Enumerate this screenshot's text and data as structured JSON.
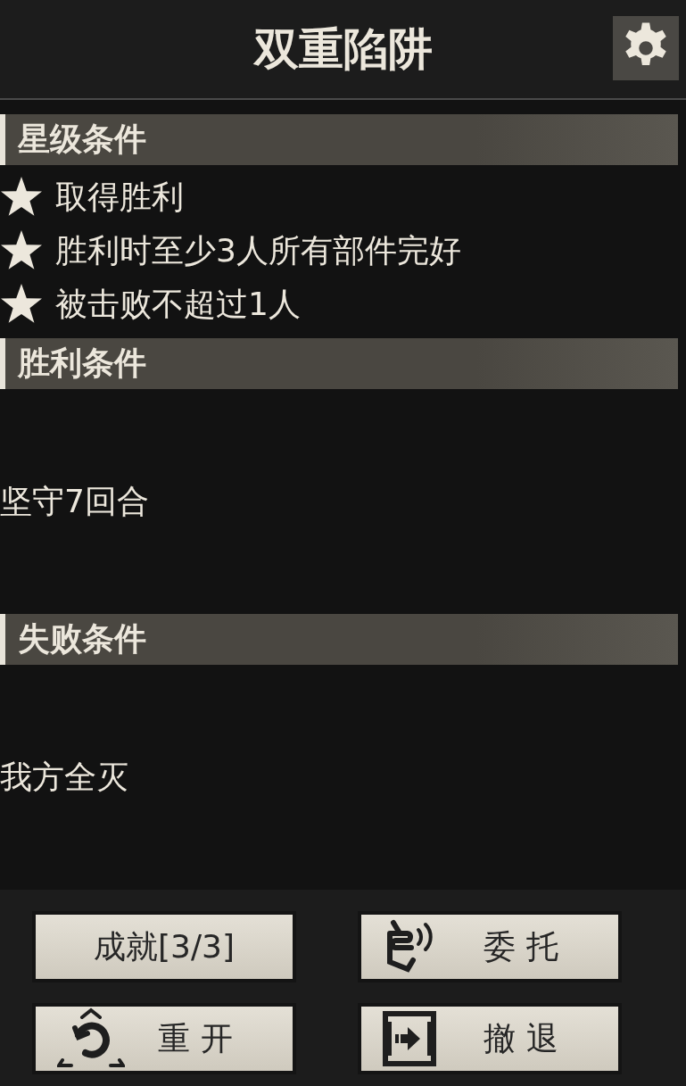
{
  "header": {
    "title": "双重陷阱"
  },
  "star_conditions": {
    "title": "星级条件",
    "items": [
      {
        "text": "取得胜利"
      },
      {
        "text": "胜利时至少3人所有部件完好"
      },
      {
        "text": "被击败不超过1人"
      }
    ]
  },
  "victory_conditions": {
    "title": "胜利条件",
    "text": "坚守7回合"
  },
  "defeat_conditions": {
    "title": "失败条件",
    "text": "我方全灭"
  },
  "buttons": [
    {
      "label": "成就[3/3]",
      "kind": "plain"
    },
    {
      "label": "委 托",
      "kind": "radio"
    },
    {
      "label": "重 开",
      "kind": "restart"
    },
    {
      "label": "撤 退",
      "kind": "retreat"
    }
  ]
}
